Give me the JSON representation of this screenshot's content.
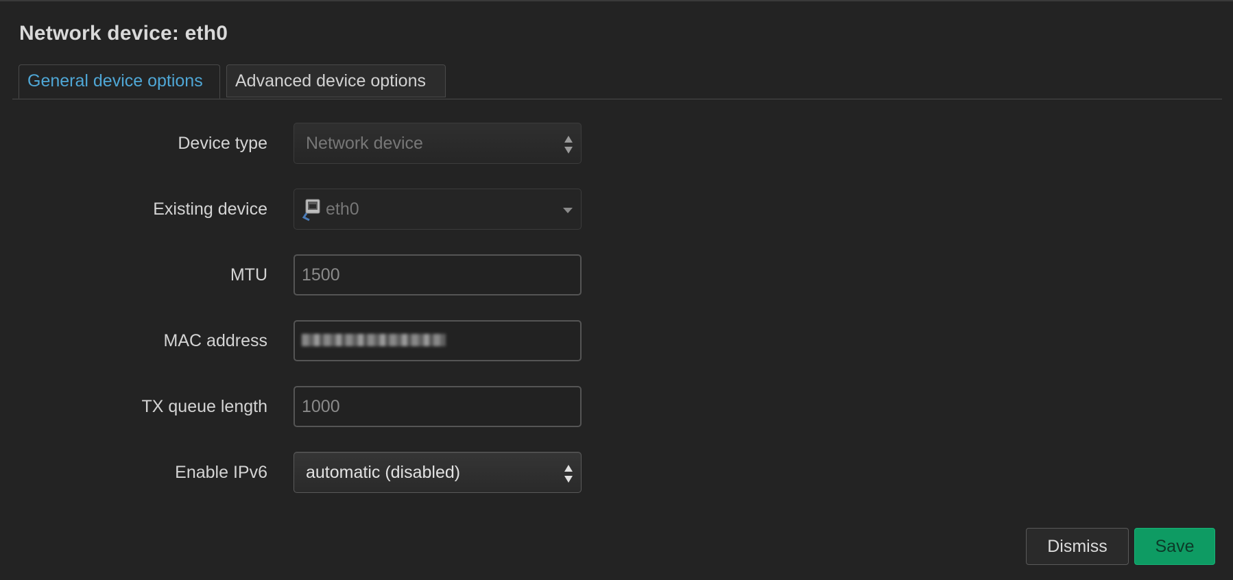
{
  "dialog": {
    "title": "Network device: eth0"
  },
  "tabs": [
    {
      "label": "General device options",
      "active": true
    },
    {
      "label": "Advanced device options",
      "active": false
    }
  ],
  "fields": {
    "device_type": {
      "label": "Device type",
      "value": "Network device"
    },
    "existing_device": {
      "label": "Existing device",
      "value": "eth0",
      "icon": "ethernet-port-icon"
    },
    "mtu": {
      "label": "MTU",
      "placeholder": "1500"
    },
    "mac_address": {
      "label": "MAC address",
      "value_redacted": true
    },
    "tx_queue_length": {
      "label": "TX queue length",
      "placeholder": "1000"
    },
    "enable_ipv6": {
      "label": "Enable IPv6",
      "value": "automatic (disabled)"
    }
  },
  "buttons": {
    "dismiss": "Dismiss",
    "save": "Save"
  },
  "colors": {
    "background": "#232323",
    "active_tab_text": "#4fa7d6",
    "save_button": "#0e9b63"
  }
}
